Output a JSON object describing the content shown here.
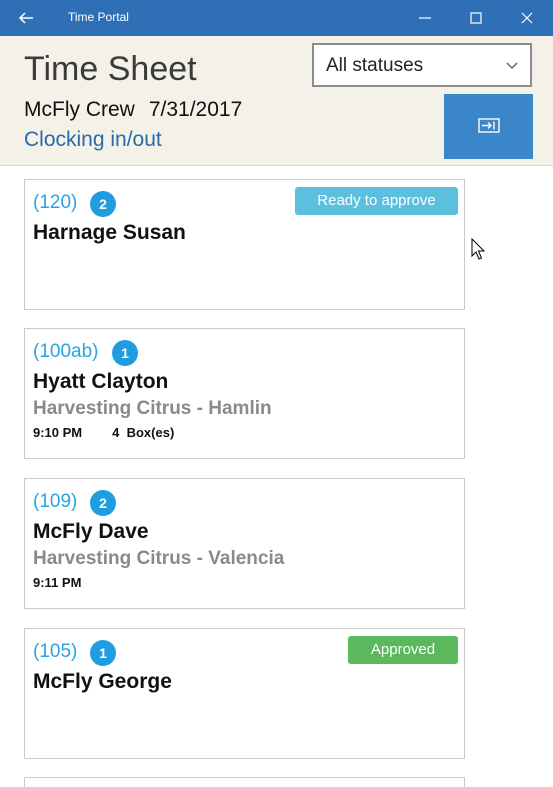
{
  "window": {
    "title": "Time Portal",
    "icons": {
      "back": "back-arrow-icon",
      "minimize": "minimize-icon",
      "maximize": "maximize-icon",
      "close": "close-icon"
    }
  },
  "header": {
    "title": "Time Sheet",
    "crew": "McFly Crew",
    "date": "7/31/2017",
    "link": "Clocking in/out",
    "status_filter": {
      "selected": "All statuses"
    },
    "action_icon": "sign-in-icon"
  },
  "colors": {
    "titlebar": "#2f6fb5",
    "accent_blue": "#3a86c8",
    "code_blue": "#2aa3e0",
    "ready": "#5bc0de",
    "approved": "#5cb85c"
  },
  "entries": [
    {
      "code": "(120)",
      "count": "2",
      "name": "Harnage Susan",
      "task": "",
      "time": "",
      "quantity": "",
      "status": "Ready to approve"
    },
    {
      "code": "(100ab)",
      "count": "1",
      "name": "Hyatt Clayton",
      "task": "Harvesting Citrus - Hamlin",
      "time": "9:10 PM",
      "quantity": "4  Box(es)",
      "status": ""
    },
    {
      "code": "(109)",
      "count": "2",
      "name": "McFly Dave",
      "task": "Harvesting Citrus - Valencia",
      "time": "9:11 PM",
      "quantity": "",
      "status": ""
    },
    {
      "code": "(105)",
      "count": "1",
      "name": "McFly George",
      "task": "",
      "time": "",
      "quantity": "",
      "status": "Approved"
    }
  ]
}
